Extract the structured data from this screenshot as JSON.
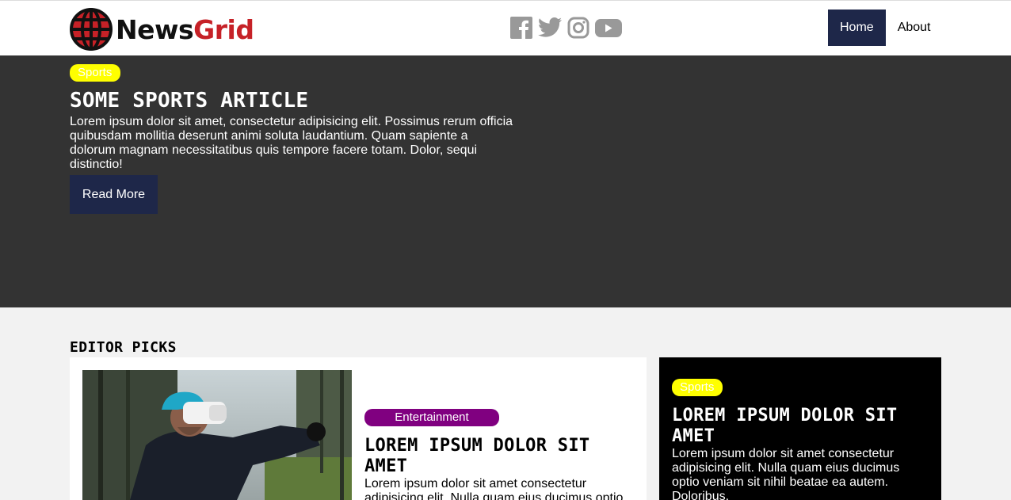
{
  "brand": {
    "part1": "News",
    "part2": "Grid",
    "accent": "#c62127"
  },
  "social": [
    {
      "icon": "facebook-icon"
    },
    {
      "icon": "twitter-icon"
    },
    {
      "icon": "instagram-icon"
    },
    {
      "icon": "youtube-icon"
    }
  ],
  "nav": {
    "home": "Home",
    "about": "About"
  },
  "hero": {
    "category": "Sports",
    "title": "SOME SPORTS ARTICLE",
    "text": "Lorem ipsum dolor sit amet, consectetur adipisicing elit. Possimus rerum officia quibusdam mollitia deserunt animi soluta laudantium. Quam sapiente a dolorum magnam necessitatibus quis tempore facere totam. Dolor, sequi distinctio!",
    "button": "Read More"
  },
  "editor_picks": {
    "heading": "EDITOR PICKS",
    "main_card": {
      "category": "Entertainment",
      "title": "LOREM IPSUM DOLOR SIT AMET",
      "text": "Lorem ipsum dolor sit amet consectetur adipisicing elit. Nulla quam eius ducimus optio veniam sit nihil beatae ea autem."
    },
    "side_card": {
      "category": "Sports",
      "title": "LOREM IPSUM DOLOR SIT AMET",
      "text": "Lorem ipsum dolor sit amet consectetur adipisicing elit. Nulla quam eius ducimus optio veniam sit nihil beatae ea autem. Doloribus."
    }
  },
  "colors": {
    "nav_active": "#1e2749",
    "hero_bg": "#333333",
    "sports_badge": "#ffff00",
    "entertainment_badge": "#800080"
  }
}
